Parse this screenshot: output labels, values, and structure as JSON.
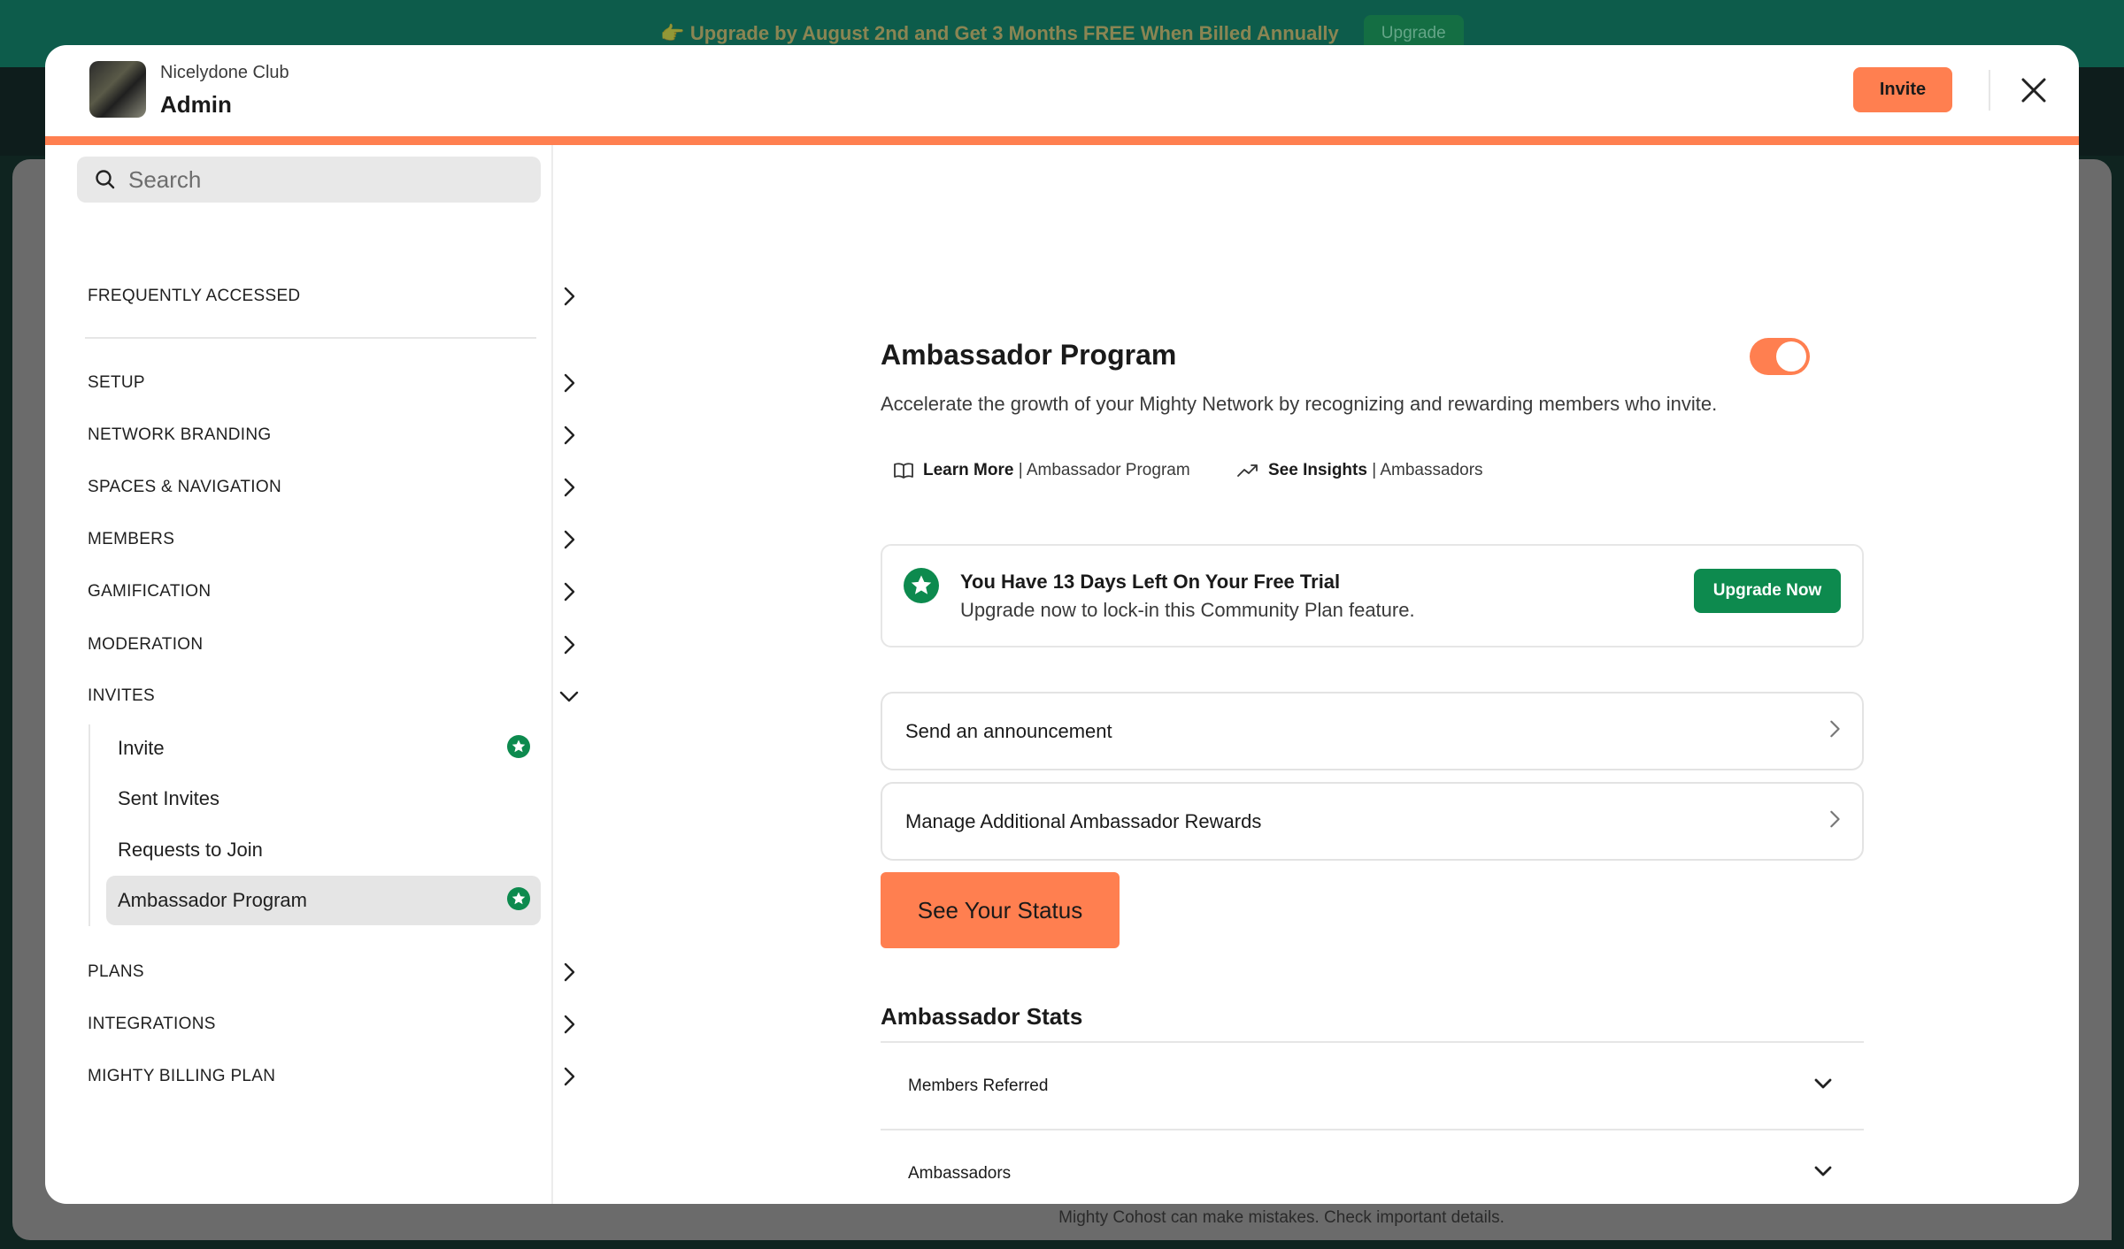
{
  "promo": {
    "text": "👉 Upgrade by August 2nd and Get 3 Months FREE When Billed Annually",
    "button": "Upgrade"
  },
  "background": {
    "footer_text": "Mighty Cohost can make mistakes. Check important details."
  },
  "header": {
    "club_name": "Nicelydone Club",
    "title": "Admin",
    "invite_label": "Invite"
  },
  "sidebar": {
    "search_placeholder": "Search",
    "frequently_accessed": "FREQUENTLY ACCESSED",
    "items": [
      {
        "label": "SETUP"
      },
      {
        "label": "NETWORK BRANDING"
      },
      {
        "label": "SPACES & NAVIGATION"
      },
      {
        "label": "MEMBERS"
      },
      {
        "label": "GAMIFICATION"
      },
      {
        "label": "MODERATION"
      },
      {
        "label": "INVITES"
      }
    ],
    "invites_sub": [
      {
        "label": "Invite",
        "badge": "star-badge-icon"
      },
      {
        "label": "Sent Invites"
      },
      {
        "label": "Requests to Join"
      },
      {
        "label": "Ambassador Program",
        "badge": "star-badge-icon",
        "active": true
      }
    ],
    "items_after": [
      {
        "label": "PLANS"
      },
      {
        "label": "INTEGRATIONS"
      },
      {
        "label": "MIGHTY BILLING PLAN"
      }
    ]
  },
  "main": {
    "title": "Ambassador Program",
    "toggle_on": true,
    "description": "Accelerate the growth of your Mighty Network by recognizing and rewarding members who invite.",
    "learn_more": {
      "bold": "Learn More",
      "rest": " | Ambassador Program"
    },
    "see_insights": {
      "bold": "See Insights",
      "rest": " | Ambassadors"
    },
    "trial": {
      "title": "You Have 13 Days Left On Your Free Trial",
      "subtitle": "Upgrade now to lock-in this Community Plan feature.",
      "button": "Upgrade Now"
    },
    "actions": [
      {
        "label": "Send an announcement"
      },
      {
        "label": "Manage Additional Ambassador Rewards"
      }
    ],
    "status_button": "See Your Status",
    "stats": {
      "title": "Ambassador Stats",
      "rows": [
        {
          "label": "Members Referred"
        },
        {
          "label": "Ambassadors"
        }
      ]
    }
  },
  "colors": {
    "accent": "#ff7f50",
    "success": "#0d8a4e",
    "banner": "#0d5c4b"
  }
}
